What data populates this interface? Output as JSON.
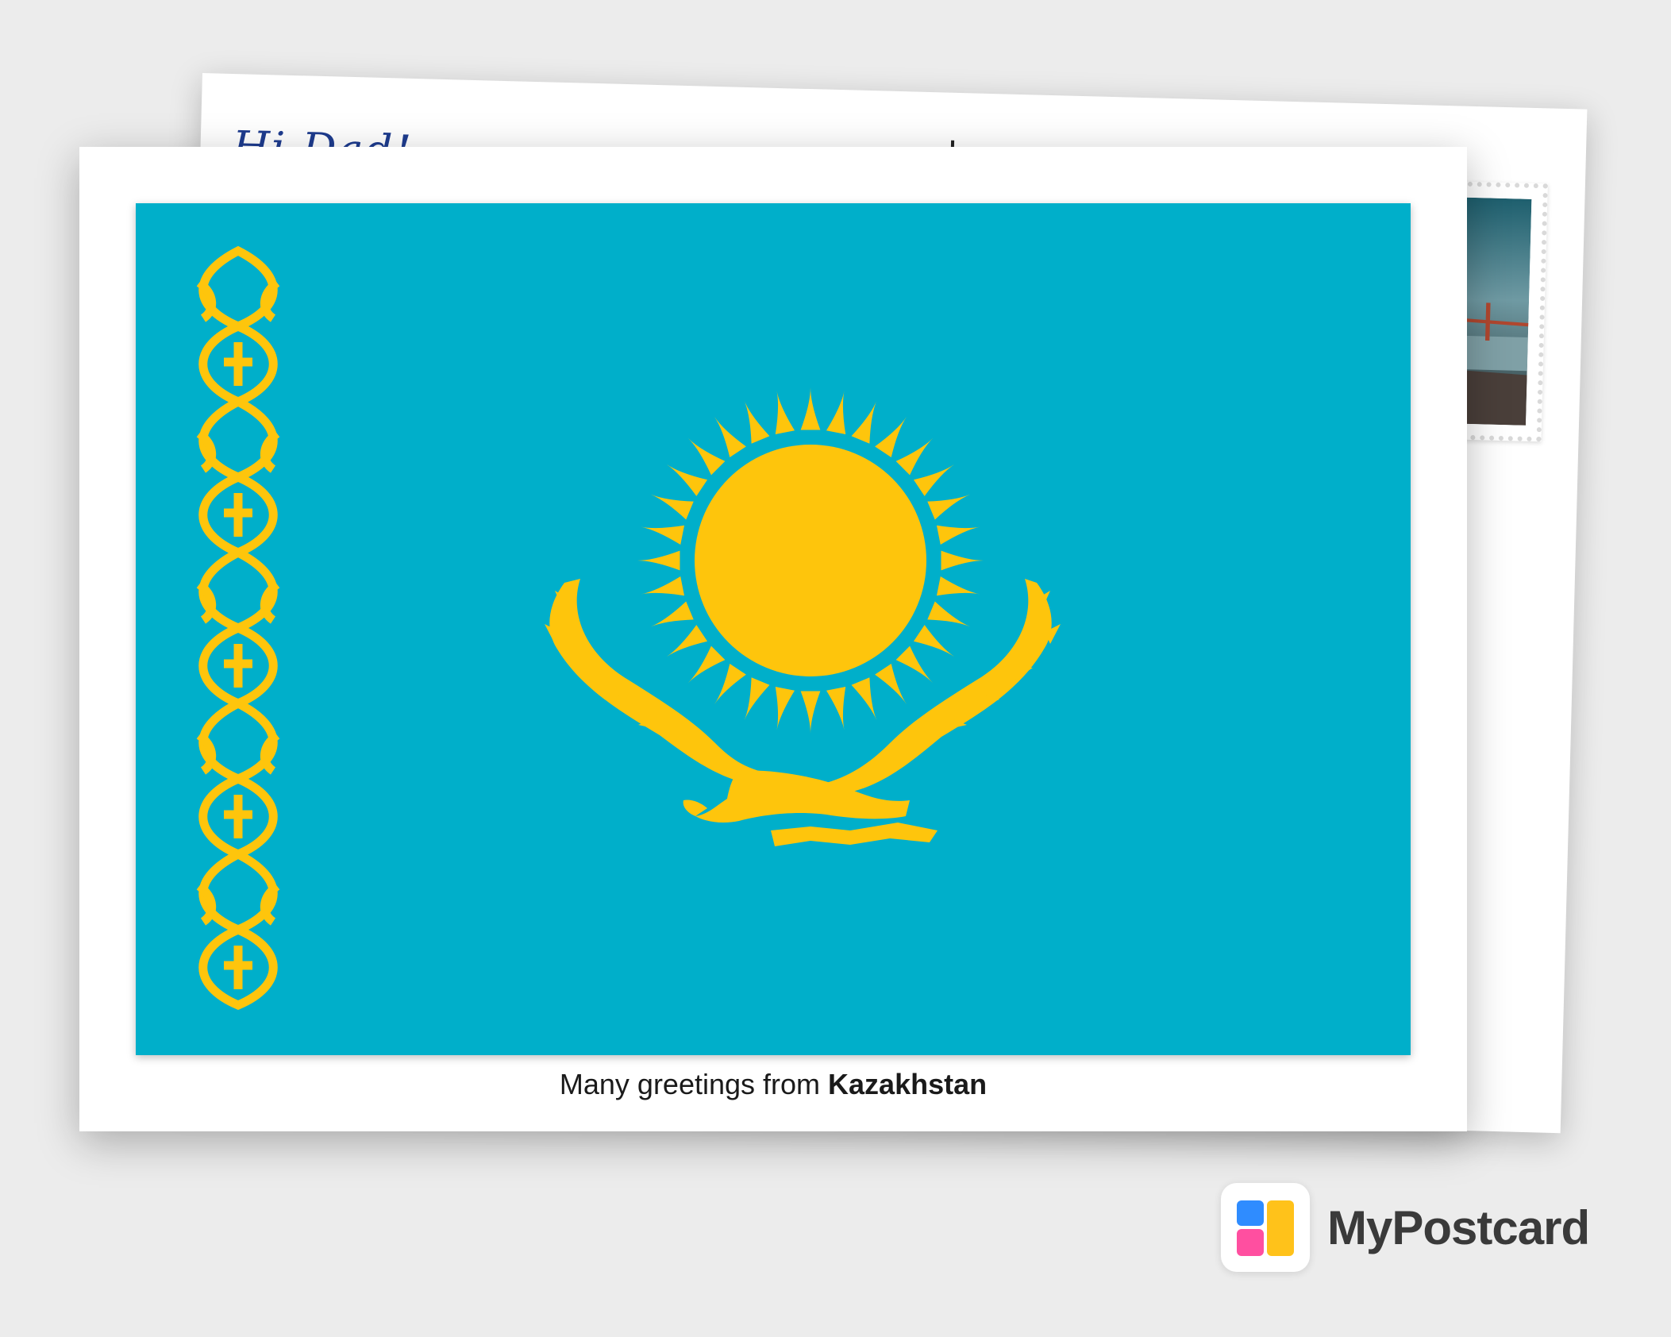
{
  "back_card": {
    "greeting_script": "Hi Dad!",
    "stamp_image": "golden-gate-bridge-photo"
  },
  "front_card": {
    "caption_prefix": "Many greetings from ",
    "caption_country": "Kazakhstan",
    "flag": {
      "name": "kazakhstan-flag",
      "field_color": "#00AFCA",
      "emblem_color": "#FEC50C"
    }
  },
  "brand": {
    "name": "MyPostcard",
    "logo_icon": "mypostcard-logo-icon"
  }
}
